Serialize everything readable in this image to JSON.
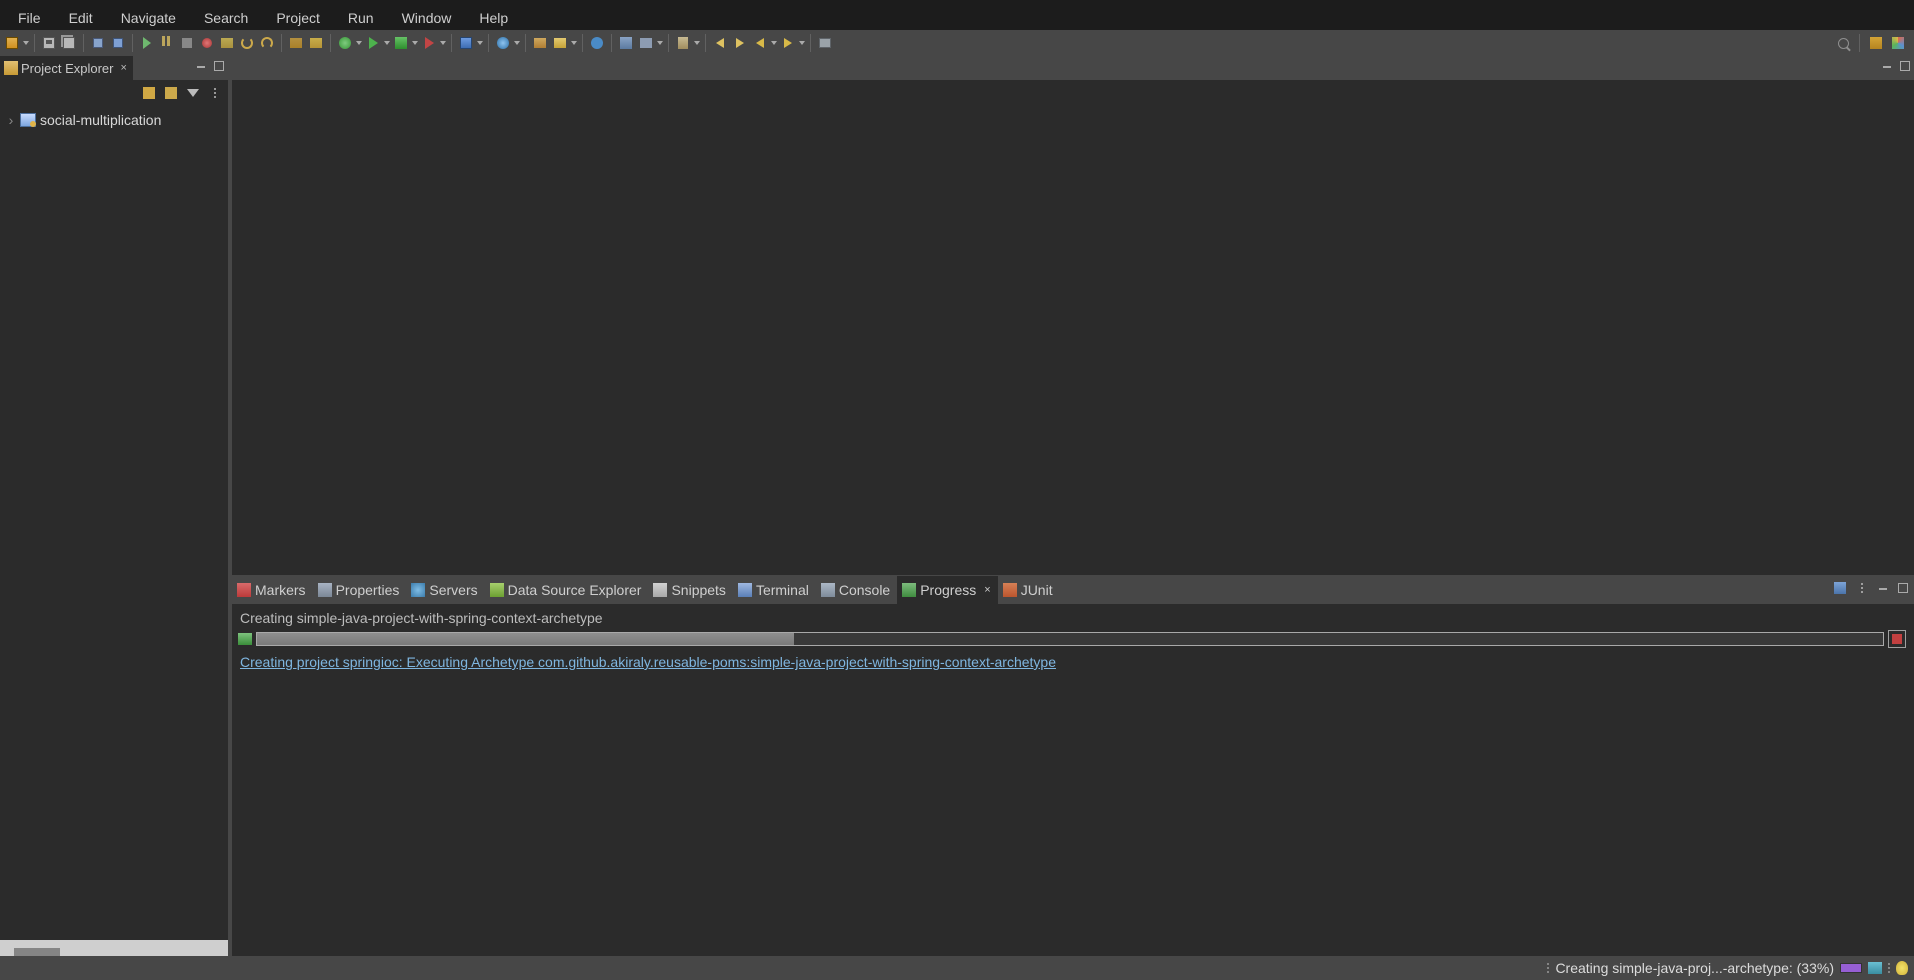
{
  "menu": {
    "file": "File",
    "edit": "Edit",
    "navigate": "Navigate",
    "search": "Search",
    "project": "Project",
    "run": "Run",
    "window": "Window",
    "help": "Help"
  },
  "sidebar": {
    "title": "Project Explorer",
    "tree": {
      "items": [
        {
          "label": "social-multiplication",
          "expanded": false
        }
      ]
    }
  },
  "bottom_tabs": {
    "markers": "Markers",
    "properties": "Properties",
    "servers": "Servers",
    "data_source_explorer": "Data Source Explorer",
    "snippets": "Snippets",
    "terminal": "Terminal",
    "console": "Console",
    "progress": "Progress",
    "junit": "JUnit"
  },
  "progress": {
    "task_title": "Creating simple-java-project-with-spring-context-archetype",
    "percent": 33,
    "subtask": "Creating project springioc: Executing Archetype com.github.akiraly.reusable-poms:simple-java-project-with-spring-context-archetype"
  },
  "status_bar": {
    "text": "Creating simple-java-proj...-archetype: (33%)"
  }
}
